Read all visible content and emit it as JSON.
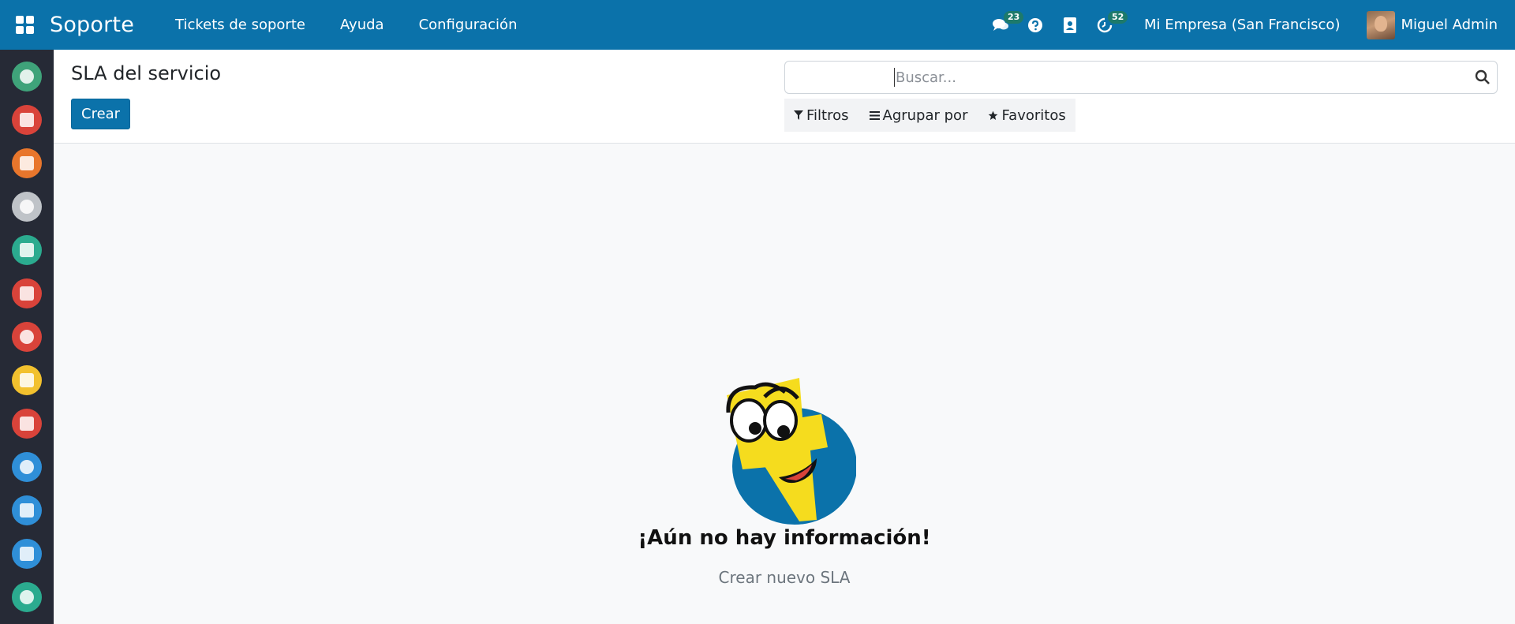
{
  "navbar": {
    "brand": "Soporte",
    "menu": [
      "Tickets de soporte",
      "Ayuda",
      "Configuración"
    ],
    "messages_count": "23",
    "activities_count": "52",
    "company": "Mi Empresa (San Francisco)",
    "user": "Miguel Admin"
  },
  "sidebar": {
    "apps": [
      {
        "name": "discuss-app",
        "color": "#3fa37a"
      },
      {
        "name": "calendar-app",
        "color": "#d9433a"
      },
      {
        "name": "notes-app",
        "color": "#e8762c"
      },
      {
        "name": "contacts-app",
        "color": "#bfc3c8"
      },
      {
        "name": "employees-app",
        "color": "#2bab8f"
      },
      {
        "name": "crm-app",
        "color": "#d9433a"
      },
      {
        "name": "sales-app",
        "color": "#d9433a"
      },
      {
        "name": "website-app",
        "color": "#f2c12e"
      },
      {
        "name": "expenses-app",
        "color": "#d9433a"
      },
      {
        "name": "pos-app",
        "color": "#2f8fd8"
      },
      {
        "name": "accounting-app",
        "color": "#2f8fd8"
      },
      {
        "name": "planning-app",
        "color": "#2f8fd8"
      },
      {
        "name": "helpdesk-app",
        "color": "#2bab8f"
      }
    ]
  },
  "control": {
    "title": "SLA del servicio",
    "create_label": "Crear",
    "search_placeholder": "Buscar...",
    "filters_label": "Filtros",
    "group_by_label": "Agrupar por",
    "favorites_label": "Favoritos"
  },
  "empty_state": {
    "title": "¡Aún no hay información!",
    "subtitle": "Crear nuevo SLA"
  },
  "colors": {
    "navbar": "#0b72aa",
    "sidebar": "#262a36",
    "badge": "#1d7a6b",
    "primary": "#0b72aa"
  }
}
